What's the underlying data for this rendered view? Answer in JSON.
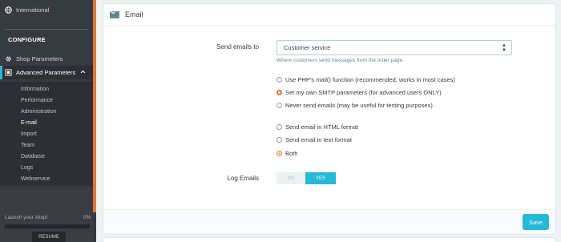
{
  "sidebar": {
    "international": "International",
    "configure": "CONFIGURE",
    "shop_parameters": "Shop Parameters",
    "advanced_parameters": "Advanced Parameters",
    "sub_items": [
      "Information",
      "Performance",
      "Administration",
      "E-mail",
      "Import",
      "Team",
      "Database",
      "Logs",
      "Webservice"
    ],
    "active_sub_item": "E-mail",
    "launch_text": "Launch your shop!",
    "launch_pct": "0%",
    "resume_label": "RESUME"
  },
  "panel": {
    "title": "Email",
    "send_to_label": "Send emails to",
    "send_to_value": "Customer service",
    "send_to_help": "Where customers send messages from the order page.",
    "method_options": [
      "Use PHP's mail() function (recommended; works in most cases)",
      "Set my own SMTP parameters (for advanced users ONLY)",
      "Never send emails (may be useful for testing purposes)"
    ],
    "format_options": [
      "Send email in HTML format",
      "Send email in text format",
      "Both"
    ],
    "log_label": "Log Emails",
    "log_no": "NO",
    "log_yes": "YES",
    "save_label": "Save"
  },
  "colors": {
    "accent": "#25b9d7",
    "brand": "#e0763a",
    "sidebar": "#363a41"
  }
}
